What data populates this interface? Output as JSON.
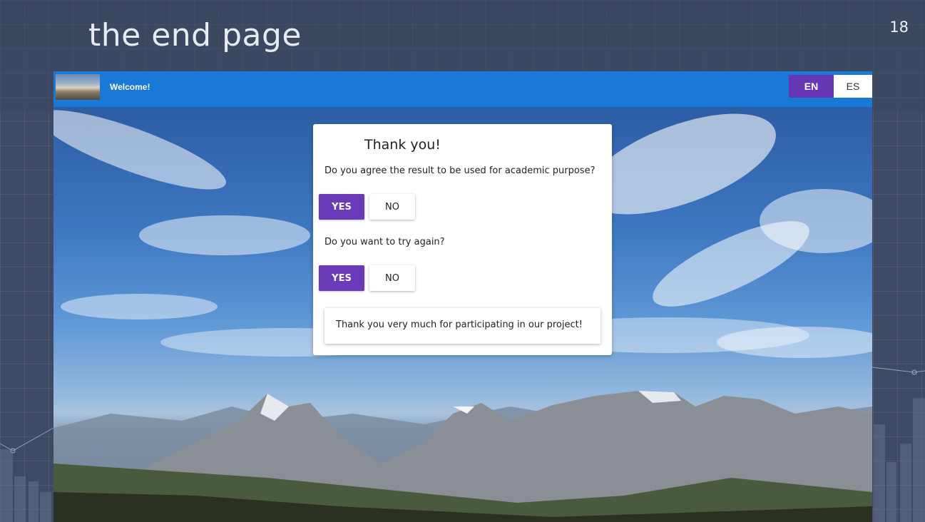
{
  "slide": {
    "title": "the end page",
    "number": "18"
  },
  "app": {
    "title": "Welcome!",
    "lang_en": "EN",
    "lang_es": "ES"
  },
  "card": {
    "title": "Thank you!",
    "question1": "Do you agree the result to be used for academic purpose?",
    "question2": "Do you want to try again?",
    "yes_label": "YES",
    "no_label": "NO",
    "thanks_message": "Thank you very much for participating in our project!"
  },
  "colors": {
    "app_bar": "#1a78d6",
    "primary_button": "#6a3ab8",
    "slide_background": "#3e4a64"
  }
}
